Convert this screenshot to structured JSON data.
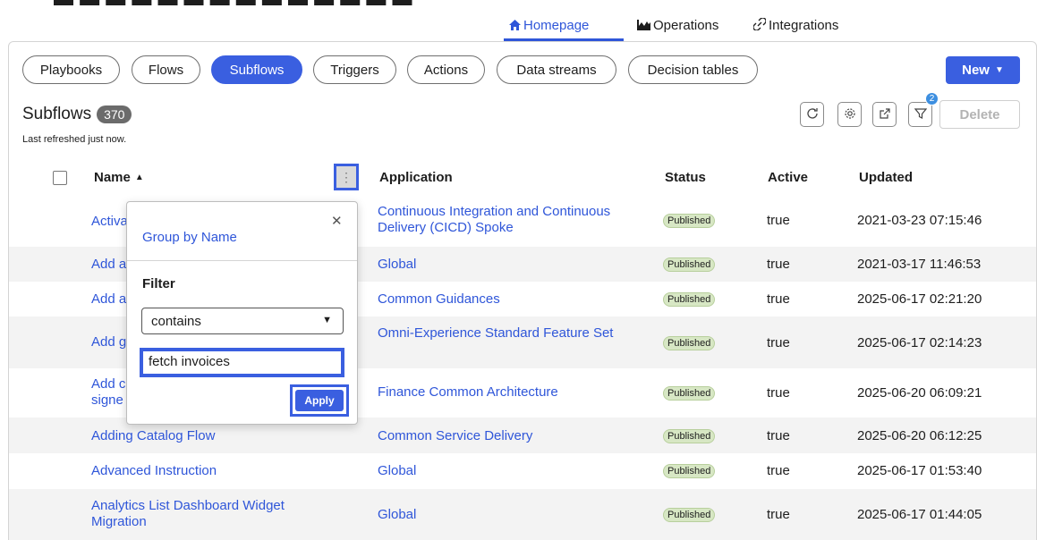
{
  "topnav": {
    "items": [
      {
        "label": "Homepage",
        "icon": "home-icon"
      },
      {
        "label": "Operations",
        "icon": "chart-icon"
      },
      {
        "label": "Integrations",
        "icon": "link-icon"
      }
    ]
  },
  "tabs": [
    "Playbooks",
    "Flows",
    "Subflows",
    "Triggers",
    "Actions",
    "Data streams",
    "Decision tables"
  ],
  "active_tab": "Subflows",
  "new_button": "New",
  "list": {
    "title": "Subflows",
    "count": "370",
    "refreshed": "Last refreshed just now."
  },
  "toolbar": {
    "filter_count": "2",
    "delete_label": "Delete"
  },
  "columns": {
    "name": "Name",
    "application": "Application",
    "status": "Status",
    "active": "Active",
    "updated": "Updated"
  },
  "rows": [
    {
      "name": "Activa",
      "application": "Continuous Integration and Continuous Delivery (CICD) Spoke",
      "status": "Published",
      "active": "true",
      "updated": "2021-03-23 07:15:46"
    },
    {
      "name": "Add a",
      "application": "Global",
      "status": "Published",
      "active": "true",
      "updated": "2021-03-17 11:46:53"
    },
    {
      "name": "Add a",
      "application": "Common Guidances",
      "status": "Published",
      "active": "true",
      "updated": "2025-06-17 02:21:20"
    },
    {
      "name": "Add g",
      "application": "Omni-Experience Standard Feature Set",
      "status": "Published",
      "active": "true",
      "updated": "2025-06-17 02:14:23"
    },
    {
      "name": "Add c signe",
      "application": "Finance Common Architecture",
      "status": "Published",
      "active": "true",
      "updated": "2025-06-20 06:09:21"
    },
    {
      "name": "Adding Catalog Flow",
      "application": "Common Service Delivery",
      "status": "Published",
      "active": "true",
      "updated": "2025-06-20 06:12:25"
    },
    {
      "name": "Advanced Instruction",
      "application": "Global",
      "status": "Published",
      "active": "true",
      "updated": "2025-06-17 01:53:40"
    },
    {
      "name": "Analytics List Dashboard Widget Migration",
      "application": "Global",
      "status": "Published",
      "active": "true",
      "updated": "2025-06-17 01:44:05"
    }
  ],
  "popup": {
    "group_by": "Group by Name",
    "filter_label": "Filter",
    "operator": "contains",
    "value": "fetch invoices",
    "apply": "Apply"
  }
}
